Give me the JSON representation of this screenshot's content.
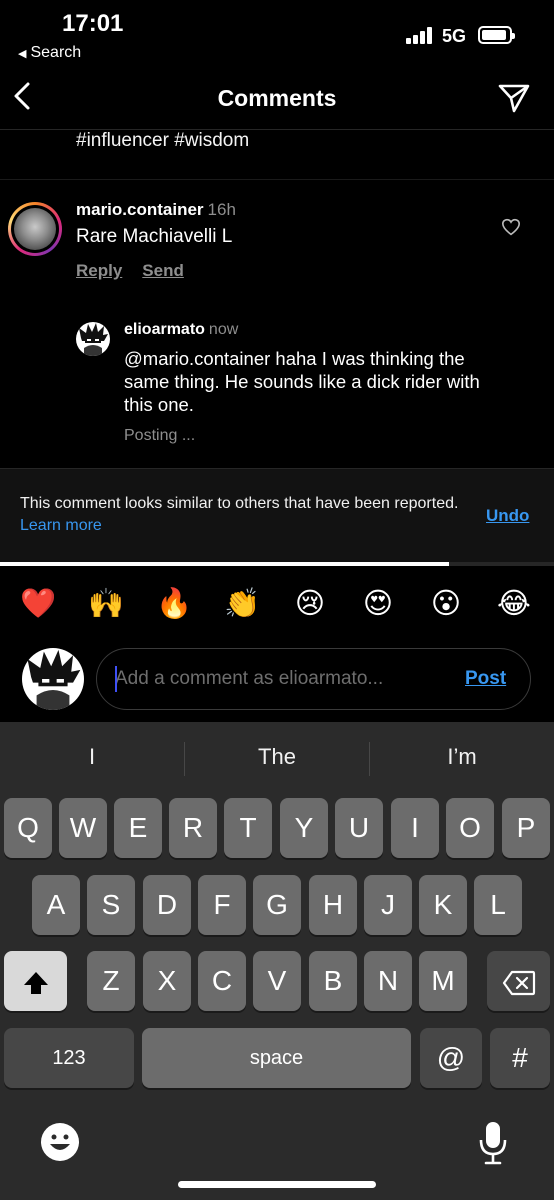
{
  "status_bar": {
    "time": "17:01",
    "back_app": "Search",
    "network": "5G"
  },
  "header": {
    "title": "Comments"
  },
  "caption_tail": "#influencer #wisdom",
  "comment": {
    "username": "mario.container",
    "timestamp": "16h",
    "text": "Rare Machiavelli L",
    "reply_label": "Reply",
    "send_label": "Send"
  },
  "reply": {
    "username": "elioarmato",
    "timestamp": "now",
    "text": "@mario.container haha I was thinking the same thing. He sounds like a dick rider with this one.",
    "status": "Posting ..."
  },
  "banner": {
    "message": "This comment looks similar to others that have been reported.",
    "learn_more": "Learn more",
    "undo": "Undo",
    "progress": 0.81
  },
  "emoji_bar": [
    "❤️",
    "🙌",
    "🔥",
    "👏",
    "😢",
    "😍",
    "😮",
    "😂"
  ],
  "composer": {
    "placeholder": "Add a comment as elioarmato...",
    "post_label": "Post"
  },
  "keyboard": {
    "suggestions": [
      "I",
      "The",
      "I’m"
    ],
    "row1": [
      "Q",
      "W",
      "E",
      "R",
      "T",
      "Y",
      "U",
      "I",
      "O",
      "P"
    ],
    "row2": [
      "A",
      "S",
      "D",
      "F",
      "G",
      "H",
      "J",
      "K",
      "L"
    ],
    "row3": [
      "Z",
      "X",
      "C",
      "V",
      "B",
      "N",
      "M"
    ],
    "numbers_label": "123",
    "space_label": "space",
    "at_label": "@",
    "hash_label": "#"
  },
  "colors": {
    "accent_blue": "#3897f0",
    "background": "#000000",
    "keyboard_bg": "#2b2b2b"
  }
}
